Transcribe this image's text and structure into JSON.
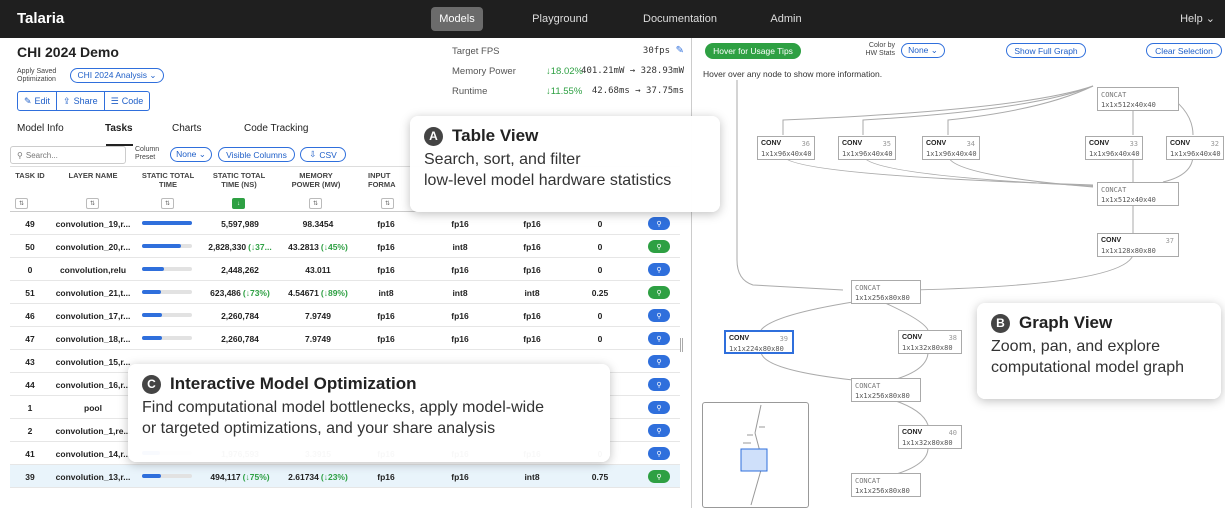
{
  "app": {
    "title": "Talaria"
  },
  "nav": {
    "items": [
      "Models",
      "Playground",
      "Documentation",
      "Admin"
    ],
    "active": "Models",
    "help": "Help ⌄"
  },
  "project": {
    "title": "CHI 2024 Demo",
    "saved_opt_label": "Apply Saved Optimization",
    "saved_opt_value": "CHI 2024 Analysis ⌄",
    "edit": "Edit",
    "share": "Share",
    "code": "Code"
  },
  "stats": {
    "fps_label": "Target FPS",
    "fps_value": "30fps",
    "memory_label": "Memory Power",
    "memory_pct": "↓18.02%",
    "memory_value": "401.21mW → 328.93mW",
    "runtime_label": "Runtime",
    "runtime_pct": "↓11.55%",
    "runtime_value": "42.68ms → 37.75ms"
  },
  "tabs": [
    "Model Info",
    "Tasks",
    "Charts",
    "Code Tracking"
  ],
  "toolbar": {
    "search_placeholder": "Search...",
    "col_preset_label": "Column Preset",
    "none": "None ⌄",
    "visible_columns": "Visible Columns",
    "csv": "CSV"
  },
  "table": {
    "headers": [
      "Task ID",
      "Layer Name",
      "Static Total Time",
      "Static Total Time (ns)",
      "Memory Power (mW)",
      "Input Forma"
    ],
    "rows": [
      {
        "id": "49",
        "name": "convolution_19,r...",
        "bar": 1.0,
        "time": "5,597,989",
        "power": "98.3454",
        "input": "fp16",
        "c6": "fp16",
        "c7": "fp16",
        "c8": "0",
        "act": "blue"
      },
      {
        "id": "50",
        "name": "convolution_20,r...",
        "bar": 0.78,
        "time": "2,828,330",
        "time_delta": "(↓37...",
        "power": "43.2813",
        "power_delta": "(↓45%)",
        "input": "fp16",
        "c6": "int8",
        "c7": "fp16",
        "c8": "0",
        "act": "green"
      },
      {
        "id": "0",
        "name": "convolution,relu",
        "bar": 0.44,
        "time": "2,448,262",
        "power": "43.011",
        "input": "fp16",
        "c6": "fp16",
        "c7": "fp16",
        "c8": "0",
        "act": "blue"
      },
      {
        "id": "51",
        "name": "convolution_21,t...",
        "bar": 0.38,
        "time": "623,486",
        "time_delta": "(↓73%)",
        "power": "4.54671",
        "power_delta": "(↓89%)",
        "input": "int8",
        "c6": "int8",
        "c7": "int8",
        "c8": "0.25",
        "act": "green"
      },
      {
        "id": "46",
        "name": "convolution_17,r...",
        "bar": 0.4,
        "time": "2,260,784",
        "power": "7.9749",
        "input": "fp16",
        "c6": "fp16",
        "c7": "fp16",
        "c8": "0",
        "act": "blue"
      },
      {
        "id": "47",
        "name": "convolution_18,r...",
        "bar": 0.4,
        "time": "2,260,784",
        "power": "7.9749",
        "input": "fp16",
        "c6": "fp16",
        "c7": "fp16",
        "c8": "0",
        "act": "blue"
      },
      {
        "id": "43",
        "name": "convolution_15,r...",
        "bar": 0.0,
        "time": "",
        "power": "",
        "input": "",
        "c6": "",
        "c7": "",
        "c8": "",
        "act": "blue"
      },
      {
        "id": "44",
        "name": "convolution_16,r...",
        "bar": 0.0,
        "time": "",
        "power": "",
        "input": "",
        "c6": "",
        "c7": "",
        "c8": "",
        "act": "blue"
      },
      {
        "id": "1",
        "name": "pool",
        "bar": 0.0,
        "time": "",
        "power": "",
        "input": "",
        "c6": "",
        "c7": "",
        "c8": "",
        "act": "blue"
      },
      {
        "id": "2",
        "name": "convolution_1,re...",
        "bar": 0.0,
        "time": "",
        "power": "",
        "input": "",
        "c6": "",
        "c7": "",
        "c8": "",
        "act": "blue"
      },
      {
        "id": "41",
        "name": "convolution_14,r...",
        "bar": 0.35,
        "time": "1,976,593",
        "power": "3.3915",
        "input": "fp16",
        "c6": "fp16",
        "c7": "fp16",
        "c8": "0",
        "act": "blue"
      },
      {
        "id": "39",
        "name": "convolution_13,r...",
        "bar": 0.38,
        "time": "494,117",
        "time_delta": "(↓75%)",
        "power": "2.61734",
        "power_delta": "(↓23%)",
        "input": "fp16",
        "c6": "fp16",
        "c7": "int8",
        "c8": "0.75",
        "act": "green"
      }
    ]
  },
  "graph": {
    "hover_tips": "Hover for Usage Tips",
    "color_by_label": "Color by HW Stats",
    "none": "None ⌄",
    "show_full": "Show Full Graph",
    "clear_selection": "Clear Selection",
    "hover_text": "Hover over any node to show more information.",
    "nodes": [
      {
        "type": "CONCAT",
        "id": "",
        "shape": "1x1x512x40x40"
      },
      {
        "type": "CONV",
        "id": "36",
        "shape": "1x1x96x40x40"
      },
      {
        "type": "CONV",
        "id": "35",
        "shape": "1x1x96x40x40"
      },
      {
        "type": "CONV",
        "id": "34",
        "shape": "1x1x96x40x40"
      },
      {
        "type": "CONV",
        "id": "33",
        "shape": "1x1x96x40x40"
      },
      {
        "type": "CONV",
        "id": "32",
        "shape": "1x1x96x40x40"
      },
      {
        "type": "CONCAT",
        "id": "",
        "shape": "1x1x512x40x40"
      },
      {
        "type": "CONV",
        "id": "37",
        "shape": "1x1x128x80x80"
      },
      {
        "type": "CONCAT",
        "id": "",
        "shape": "1x1x256x80x80"
      },
      {
        "type": "CONV",
        "id": "39",
        "shape": "1x1x224x80x80"
      },
      {
        "type": "CONV",
        "id": "38",
        "shape": "1x1x32x80x80"
      },
      {
        "type": "CONCAT",
        "id": "",
        "shape": "1x1x256x80x80"
      },
      {
        "type": "CONV",
        "id": "40",
        "shape": "1x1x32x80x80"
      },
      {
        "type": "CONCAT",
        "id": "",
        "shape": "1x1x256x80x80"
      }
    ]
  },
  "callouts": {
    "a": {
      "badge": "A",
      "title": "Table View",
      "desc1": "Search, sort, and filter",
      "desc2": "low-level model hardware statistics"
    },
    "b": {
      "badge": "B",
      "title": "Graph View",
      "desc1": "Zoom, pan, and explore",
      "desc2": "computational model graph"
    },
    "c": {
      "badge": "C",
      "title": "Interactive Model Optimization",
      "desc1": "Find computational model bottlenecks, apply model-wide",
      "desc2": "or targeted optimizations, and your share analysis"
    }
  },
  "colors": {
    "accent": "#2f6fdc",
    "good": "#2ea043",
    "topbar": "#1f1f1f"
  }
}
